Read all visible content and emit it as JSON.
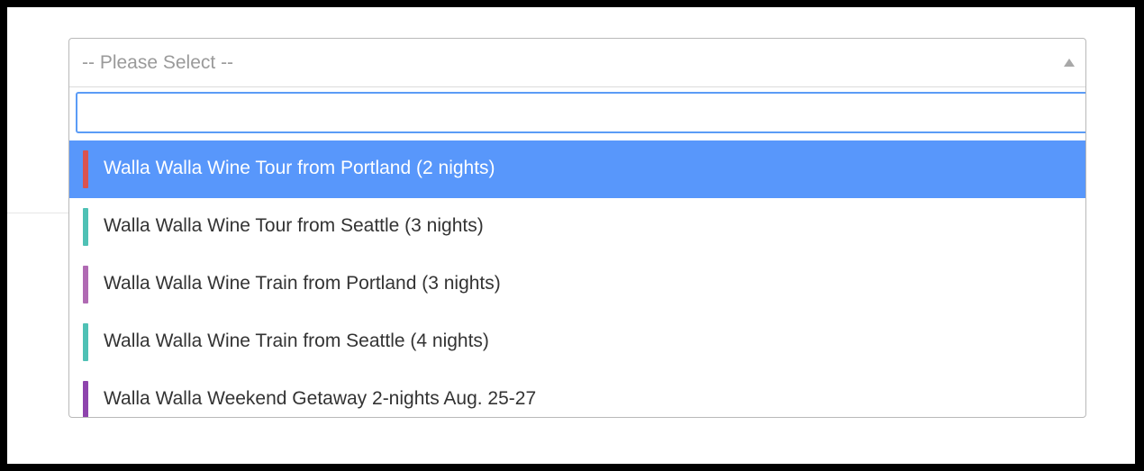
{
  "select": {
    "placeholder": "-- Please Select --",
    "search_value": "",
    "options": [
      {
        "label": "Walla Walla Wine Tour from Portland (2 nights)",
        "color": "#d9534f",
        "highlighted": true
      },
      {
        "label": "Walla Walla Wine Tour from Seattle (3 nights)",
        "color": "#4fc1b5",
        "highlighted": false
      },
      {
        "label": "Walla Walla Wine Train from Portland (3 nights)",
        "color": "#b06ab3",
        "highlighted": false
      },
      {
        "label": "Walla Walla Wine Train from Seattle (4 nights)",
        "color": "#4fc1b5",
        "highlighted": false
      },
      {
        "label": "Walla Walla Weekend Getaway 2-nights Aug. 25-27",
        "color": "#8e44ad",
        "highlighted": false
      }
    ]
  },
  "colors": {
    "highlight": "#5897fb",
    "focus_border": "#5b9cf6",
    "frame": "#000000"
  }
}
